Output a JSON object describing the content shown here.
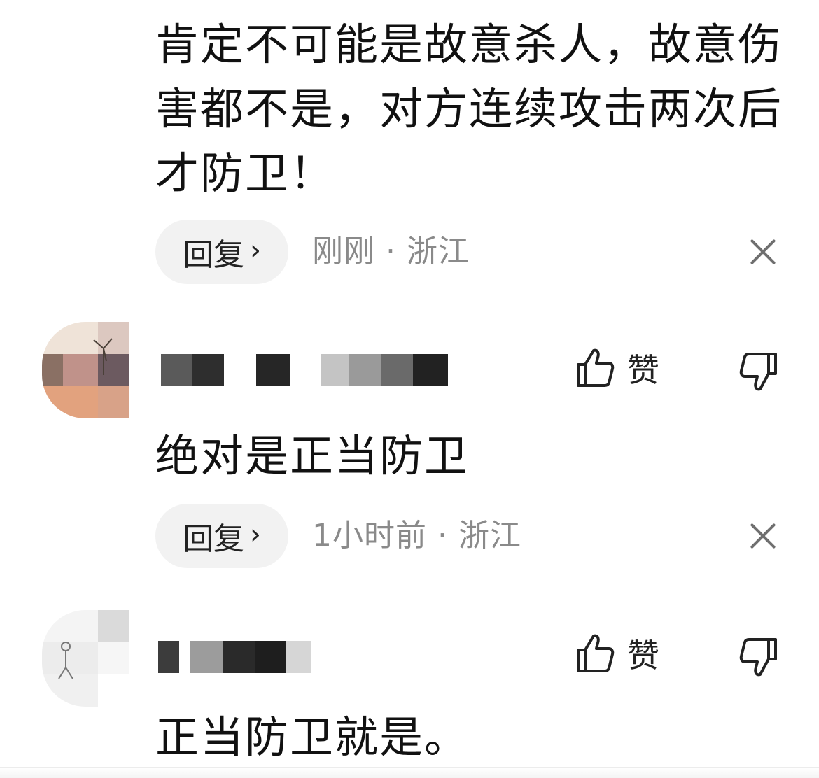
{
  "comments": [
    {
      "text": "肯定不可能是故意杀人，故意伤\n害都不是，对方连续攻击两次后\n才防卫！",
      "reply_label": "回复",
      "reply_chevron": "›",
      "meta": "刚刚 · 浙江",
      "close_icon": "close-icon"
    },
    {
      "like_label": "赞",
      "text": "绝对是正当防卫",
      "reply_label": "回复",
      "reply_chevron": "›",
      "meta": "1小时前 · 浙江",
      "close_icon": "close-icon"
    },
    {
      "like_label": "赞",
      "text": "正当防卫就是。"
    }
  ],
  "colors": {
    "text": "#111111",
    "meta": "#8a8a8a",
    "pill_bg": "#f2f2f2",
    "icon": "#222222"
  },
  "icons": [
    "thumbs-up-icon",
    "thumbs-down-icon",
    "close-icon",
    "chevron-right-icon"
  ]
}
